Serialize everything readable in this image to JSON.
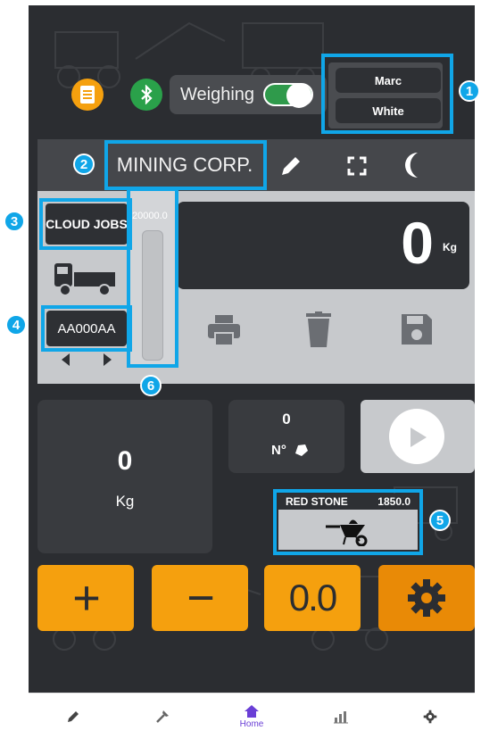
{
  "header": {
    "weighing_label": "Weighing",
    "weighing_toggle_on": true,
    "user_first": "Marc",
    "user_last": "White"
  },
  "title_bar": {
    "company_name": "MINING CORP."
  },
  "work": {
    "cloud_jobs_label": "CLOUD JOBS",
    "plate": "AA000AA",
    "gauge_max": "20000.0",
    "weight_value": "0",
    "weight_unit": "Kg"
  },
  "stats": {
    "total_value": "0",
    "total_unit": "Kg",
    "count_value": "0",
    "count_label": "N°"
  },
  "material": {
    "name": "RED STONE",
    "value": "1850.0"
  },
  "actions": {
    "plus": "+",
    "minus": "−",
    "tare": "0.0"
  },
  "bottom_nav": {
    "home_label": "Home"
  },
  "annotations": {
    "b1": "1",
    "b2": "2",
    "b3": "3",
    "b4": "4",
    "b5": "5",
    "b6": "6"
  },
  "colors": {
    "accent": "#10a6e8",
    "orange": "#f5a00e",
    "toggle_green": "#2f9a4b",
    "nav_active": "#6a3fd6"
  }
}
